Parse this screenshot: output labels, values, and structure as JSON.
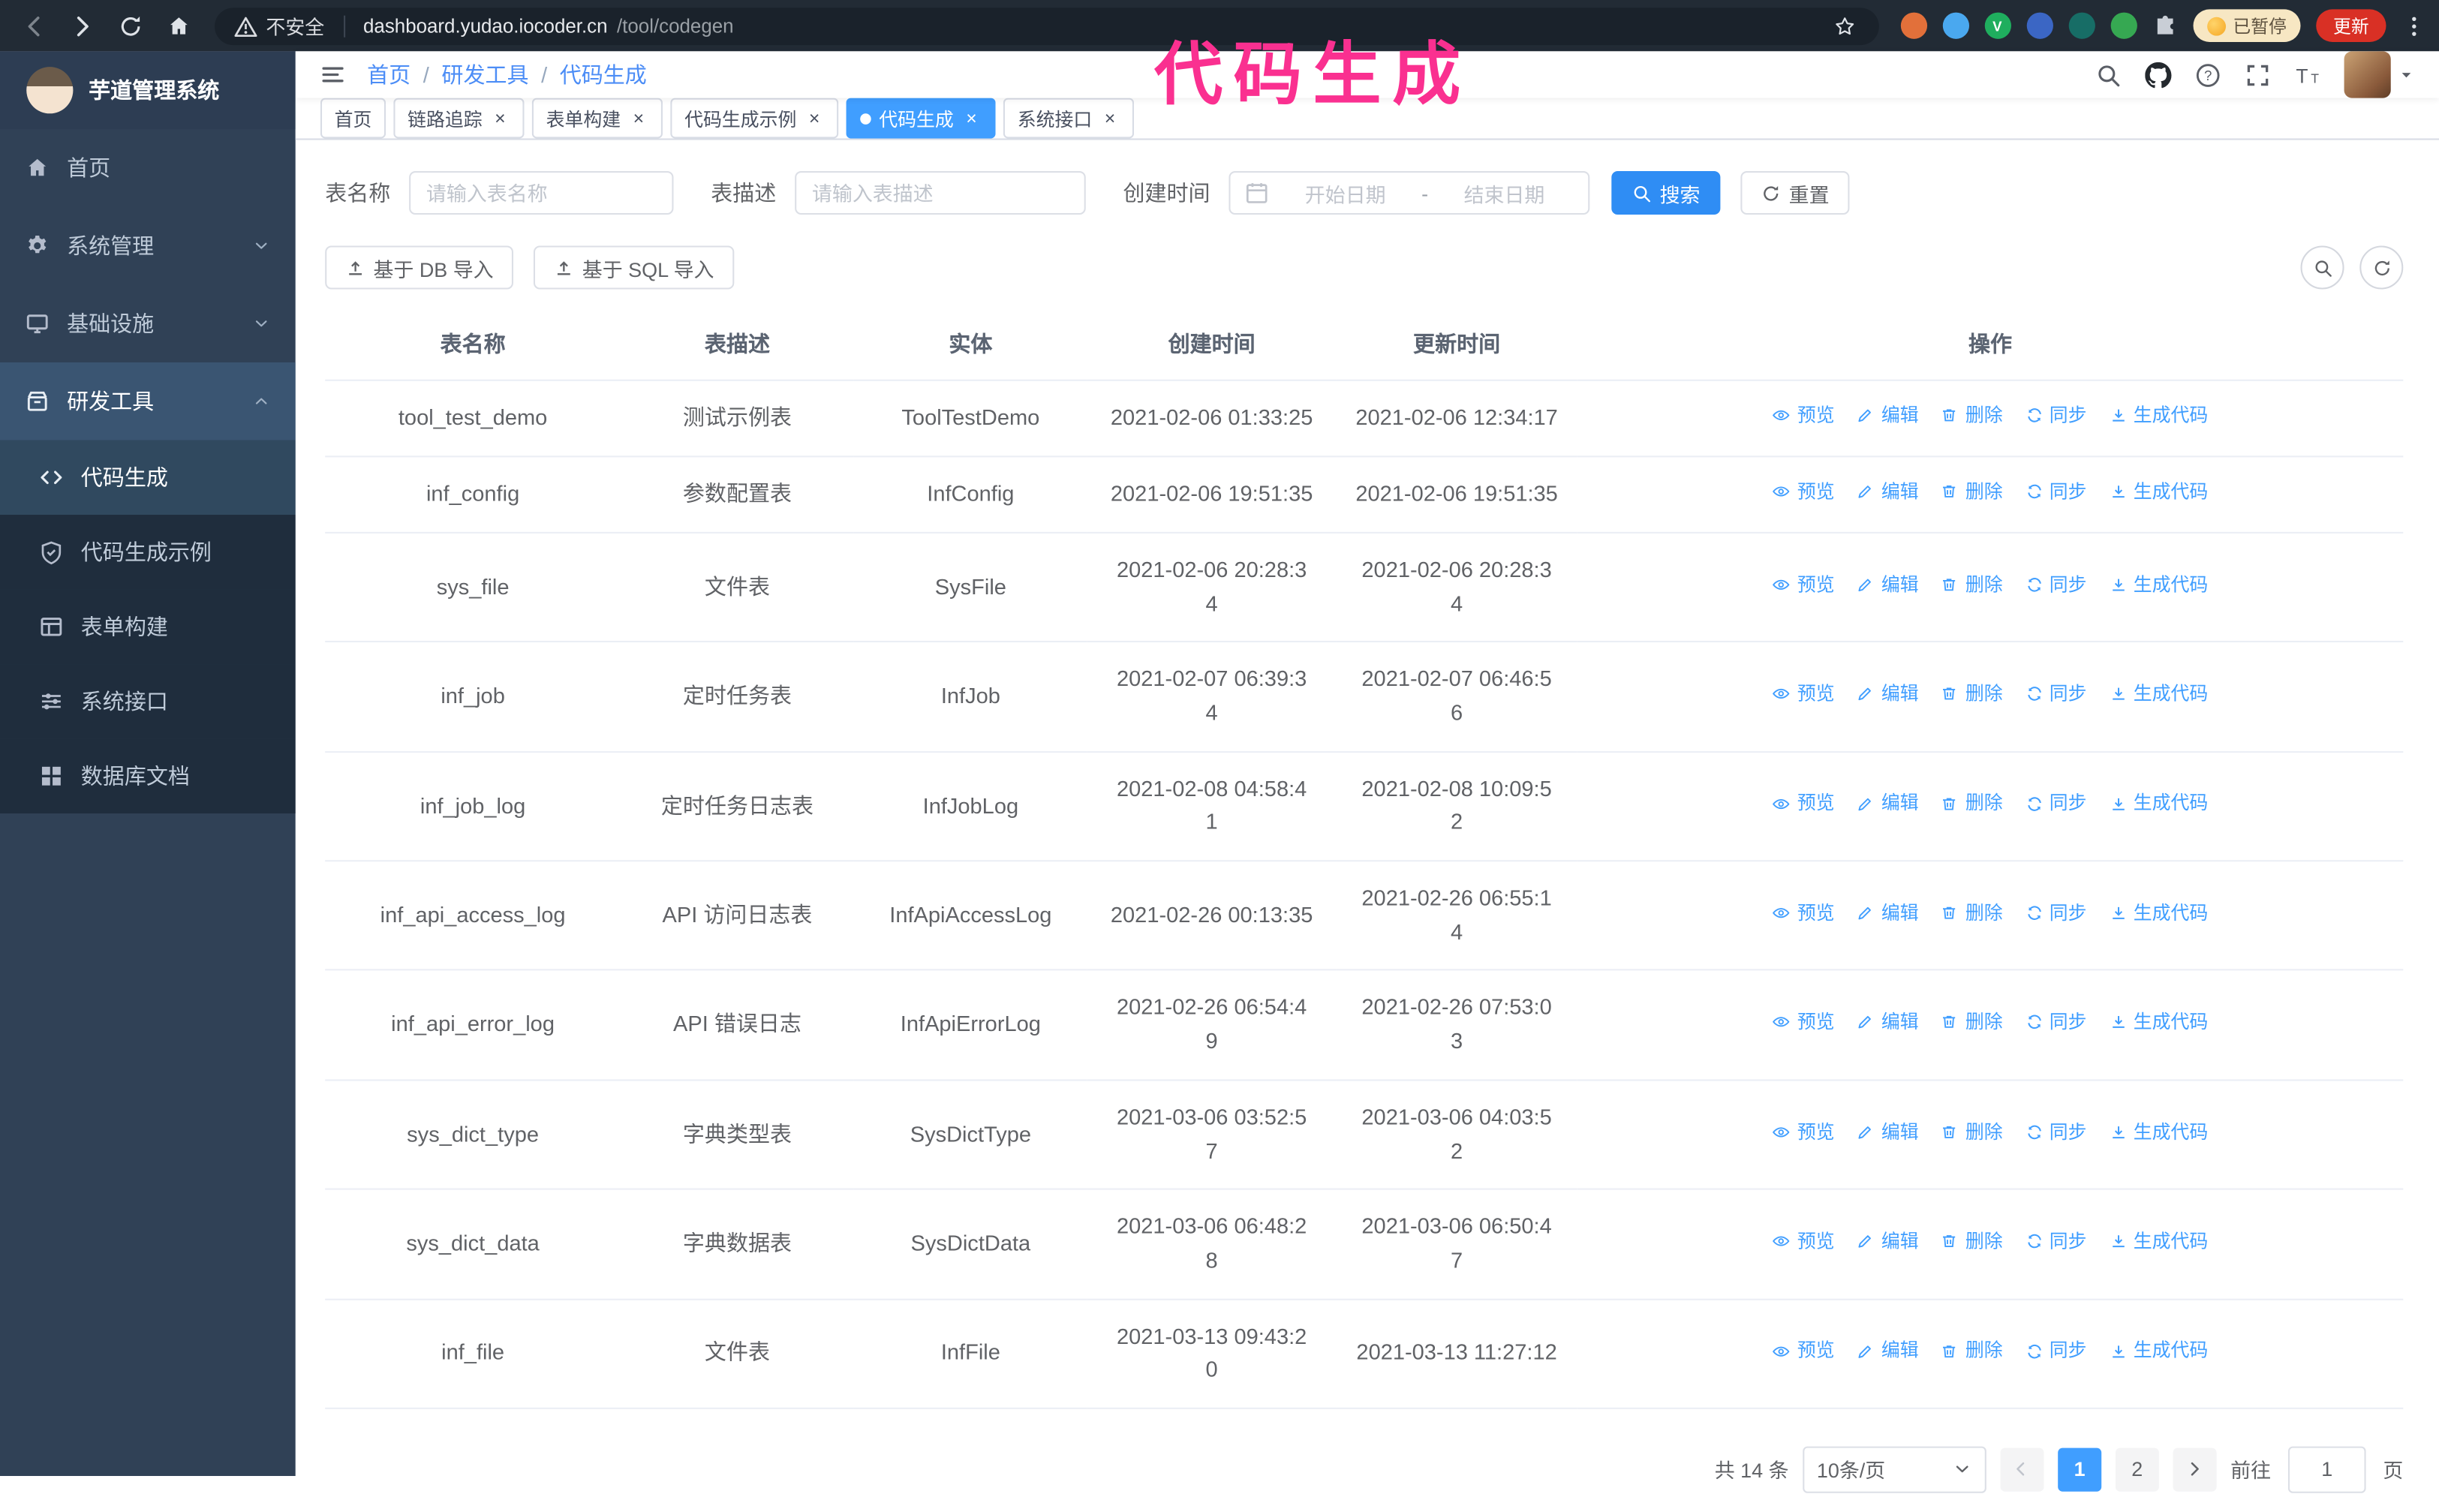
{
  "colors": {
    "primary": "#409eff",
    "annotation_pink": "#fa3090",
    "sidebar_bg": "#304156",
    "submenu_bg": "#1f2d3d",
    "chrome_bg": "#222b35"
  },
  "annotation": {
    "text": "代码生成"
  },
  "browser": {
    "nav_icons": [
      "back-icon",
      "forward-icon",
      "reload-icon",
      "home-icon"
    ],
    "security_warning": "不安全",
    "url_host": "dashboard.yudao.iocoder.cn",
    "url_path": "/tool/codegen",
    "extensions": [
      {
        "name": "extension-orange-dot",
        "color": "#e2703a",
        "glyph": ""
      },
      {
        "name": "extension-blue-dot",
        "color": "#4aa8ef",
        "glyph": ""
      },
      {
        "name": "extension-green-v-dot",
        "color": "#1fae5e",
        "glyph": "V"
      },
      {
        "name": "extension-indigo-dot",
        "color": "#3b66c4",
        "glyph": ""
      },
      {
        "name": "extension-teal-dot",
        "color": "#176d66",
        "glyph": ""
      },
      {
        "name": "extension-leaf-dot",
        "color": "#36a852",
        "glyph": ""
      }
    ],
    "paused_badge": "已暂停",
    "update_button": "更新"
  },
  "sidebar": {
    "logo_title": "芋道管理系统",
    "items": [
      {
        "id": "home",
        "label": "首页",
        "icon": "home-icon",
        "type": "item"
      },
      {
        "id": "system",
        "label": "系统管理",
        "icon": "gear-icon",
        "type": "group",
        "chevron": "down"
      },
      {
        "id": "infra",
        "label": "基础设施",
        "icon": "infra-icon",
        "type": "group",
        "chevron": "down"
      },
      {
        "id": "devtools",
        "label": "研发工具",
        "icon": "tools-icon",
        "type": "group",
        "chevron": "up",
        "expanded": true
      },
      {
        "id": "codegen",
        "label": "代码生成",
        "icon": "code-icon",
        "type": "subitem",
        "active": true
      },
      {
        "id": "codegen-example",
        "label": "代码生成示例",
        "icon": "example-icon",
        "type": "subitem"
      },
      {
        "id": "form-build",
        "label": "表单构建",
        "icon": "form-icon",
        "type": "subitem"
      },
      {
        "id": "api",
        "label": "系统接口",
        "icon": "api-icon",
        "type": "subitem"
      },
      {
        "id": "db-doc",
        "label": "数据库文档",
        "icon": "db-doc-icon",
        "type": "subitem"
      }
    ]
  },
  "navbar": {
    "breadcrumb": [
      "首页",
      "研发工具",
      "代码生成"
    ],
    "right_icons": [
      "search-icon",
      "github-icon",
      "question-icon",
      "fullscreen-icon",
      "fontsize-icon"
    ]
  },
  "tags": [
    {
      "label": "首页",
      "closable": false,
      "active": false
    },
    {
      "label": "链路追踪",
      "closable": true,
      "active": false
    },
    {
      "label": "表单构建",
      "closable": true,
      "active": false
    },
    {
      "label": "代码生成示例",
      "closable": true,
      "active": false
    },
    {
      "label": "代码生成",
      "closable": true,
      "active": true
    },
    {
      "label": "系统接口",
      "closable": true,
      "active": false
    }
  ],
  "filters": {
    "table_name_label": "表名称",
    "table_name_placeholder": "请输入表名称",
    "table_desc_label": "表描述",
    "table_desc_placeholder": "请输入表描述",
    "create_time_label": "创建时间",
    "date_start_placeholder": "开始日期",
    "date_separator": "-",
    "date_end_placeholder": "结束日期",
    "search_button": "搜索",
    "reset_button": "重置"
  },
  "toolbar": {
    "import_db_button": "基于 DB 导入",
    "import_sql_button": "基于 SQL 导入",
    "mini_buttons": [
      "search-icon",
      "refresh-icon"
    ]
  },
  "table": {
    "columns": [
      "表名称",
      "表描述",
      "实体",
      "创建时间",
      "更新时间",
      "操作"
    ],
    "actions": [
      {
        "label": "预览",
        "icon": "eye-icon",
        "id": "preview"
      },
      {
        "label": "编辑",
        "icon": "edit-icon",
        "id": "edit"
      },
      {
        "label": "删除",
        "icon": "delete-icon",
        "id": "delete"
      },
      {
        "label": "同步",
        "icon": "sync-icon",
        "id": "sync"
      },
      {
        "label": "生成代码",
        "icon": "download-icon",
        "id": "generate-code"
      }
    ],
    "rows": [
      {
        "name": "tool_test_demo",
        "desc": "测试示例表",
        "entity": "ToolTestDemo",
        "created": "2021-02-06 01:33:25",
        "updated": "2021-02-06 12:34:17"
      },
      {
        "name": "inf_config",
        "desc": "参数配置表",
        "entity": "InfConfig",
        "created": "2021-02-06 19:51:35",
        "updated": "2021-02-06 19:51:35"
      },
      {
        "name": "sys_file",
        "desc": "文件表",
        "entity": "SysFile",
        "created": "2021-02-06 20:28:3\n4",
        "updated": "2021-02-06 20:28:3\n4"
      },
      {
        "name": "inf_job",
        "desc": "定时任务表",
        "entity": "InfJob",
        "created": "2021-02-07 06:39:3\n4",
        "updated": "2021-02-07 06:46:5\n6"
      },
      {
        "name": "inf_job_log",
        "desc": "定时任务日志表",
        "entity": "InfJobLog",
        "created": "2021-02-08 04:58:4\n1",
        "updated": "2021-02-08 10:09:5\n2"
      },
      {
        "name": "inf_api_access_log",
        "desc": "API 访问日志表",
        "entity": "InfApiAccessLog",
        "created": "2021-02-26 00:13:35",
        "updated": "2021-02-26 06:55:1\n4"
      },
      {
        "name": "inf_api_error_log",
        "desc": "API 错误日志",
        "entity": "InfApiErrorLog",
        "created": "2021-02-26 06:54:4\n9",
        "updated": "2021-02-26 07:53:0\n3"
      },
      {
        "name": "sys_dict_type",
        "desc": "字典类型表",
        "entity": "SysDictType",
        "created": "2021-03-06 03:52:5\n7",
        "updated": "2021-03-06 04:03:5\n2"
      },
      {
        "name": "sys_dict_data",
        "desc": "字典数据表",
        "entity": "SysDictData",
        "created": "2021-03-06 06:48:2\n8",
        "updated": "2021-03-06 06:50:4\n7"
      },
      {
        "name": "inf_file",
        "desc": "文件表",
        "entity": "InfFile",
        "created": "2021-03-13 09:43:2\n0",
        "updated": "2021-03-13 11:27:12"
      }
    ]
  },
  "pagination": {
    "total": "共 14 条",
    "page_size": "10条/页",
    "pages": [
      "1",
      "2"
    ],
    "active_page": "1",
    "goto_label": "前往",
    "goto_value": "1",
    "goto_suffix": "页"
  }
}
